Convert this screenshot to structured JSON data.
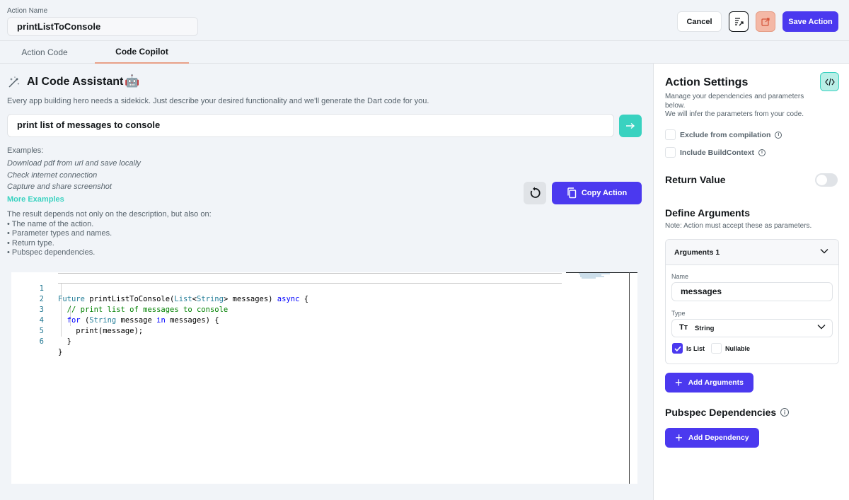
{
  "header": {
    "action_name_label": "Action Name",
    "action_name_value": "printListToConsole",
    "cancel_label": "Cancel",
    "save_label": "Save Action"
  },
  "tabs": [
    {
      "label": "Action Code",
      "active": false
    },
    {
      "label": "Code Copilot",
      "active": true
    }
  ],
  "assistant": {
    "title": "AI Code Assistant",
    "robot_emoji": "🤖",
    "description": "Every app building hero needs a sidekick. Just describe your desired functionality and we'll generate the Dart code for you.",
    "prompt_value": "print list of messages to console",
    "examples_heading": "Examples:",
    "examples": [
      "Download pdf from url and save locally",
      "Check internet connection",
      "Capture and share screenshot"
    ],
    "more_examples_label": "More Examples",
    "result_info": [
      "The result depends not only on the description, but also on:",
      "• The name of the action.",
      "• Parameter types and names.",
      "• Return type.",
      "• Pubspec dependencies."
    ],
    "copy_action_label": "Copy Action"
  },
  "code": {
    "line_numbers": [
      "1",
      "2",
      "3",
      "4",
      "5",
      "6"
    ]
  },
  "settings": {
    "title": "Action Settings",
    "description": "Manage your dependencies and parameters below.",
    "description_2": "We will infer the parameters from your code.",
    "exclude_label": "Exclude from compilation",
    "include_context_label": "Include BuildContext",
    "return_value_label": "Return Value",
    "return_value_enabled": false,
    "define_args_title": "Define Arguments",
    "define_args_note": "Note: Action must accept these as parameters.",
    "argument": {
      "header": "Arguments 1",
      "name_label": "Name",
      "name_value": "messages",
      "type_label": "Type",
      "type_value": "String",
      "is_list_label": "Is List",
      "is_list_checked": true,
      "nullable_label": "Nullable",
      "nullable_checked": false
    },
    "add_arguments_label": "Add Arguments",
    "pubspec_title": "Pubspec Dependencies",
    "add_dependency_label": "Add Dependency"
  },
  "colors": {
    "primary": "#4b39ef",
    "secondary": "#39d2c0",
    "tertiary": "#f4b8a6",
    "background": "#f1f4f8"
  }
}
